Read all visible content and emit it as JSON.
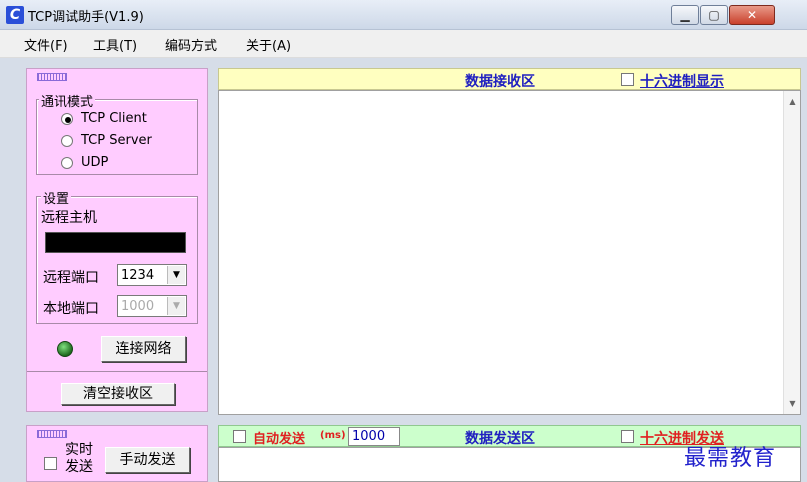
{
  "window": {
    "title": "TCP调试助手(V1.9)",
    "icon": "app-logo-icon"
  },
  "menu": [
    "文件(F)",
    "工具(T)",
    "编码方式",
    "关于(A)"
  ],
  "left": {
    "comm_mode": {
      "legend": "通讯模式",
      "options": [
        "TCP Client",
        "TCP Server",
        "UDP"
      ],
      "selected": "TCP Client"
    },
    "settings": {
      "legend": "设置",
      "remote_host_label": "远程主机",
      "remote_host_value": "",
      "remote_port_label": "远程端口",
      "remote_port_value": "1234",
      "local_port_label": "本地端口",
      "local_port_value": "1000"
    },
    "connect_button": "连接网络",
    "status_led_color": "#2e8b2e",
    "clear_button": "清空接收区",
    "realtime_send_label_1": "实时",
    "realtime_send_label_2": "发送",
    "manual_send_button": "手动发送"
  },
  "receive": {
    "title": "数据接收区",
    "hex_label": "十六进制显示"
  },
  "send": {
    "auto_label": "自动发送",
    "ms_label": "(ms)",
    "interval": "1000",
    "title": "数据发送区",
    "hex_label": "十六进制发送"
  },
  "watermark": "最需教育"
}
